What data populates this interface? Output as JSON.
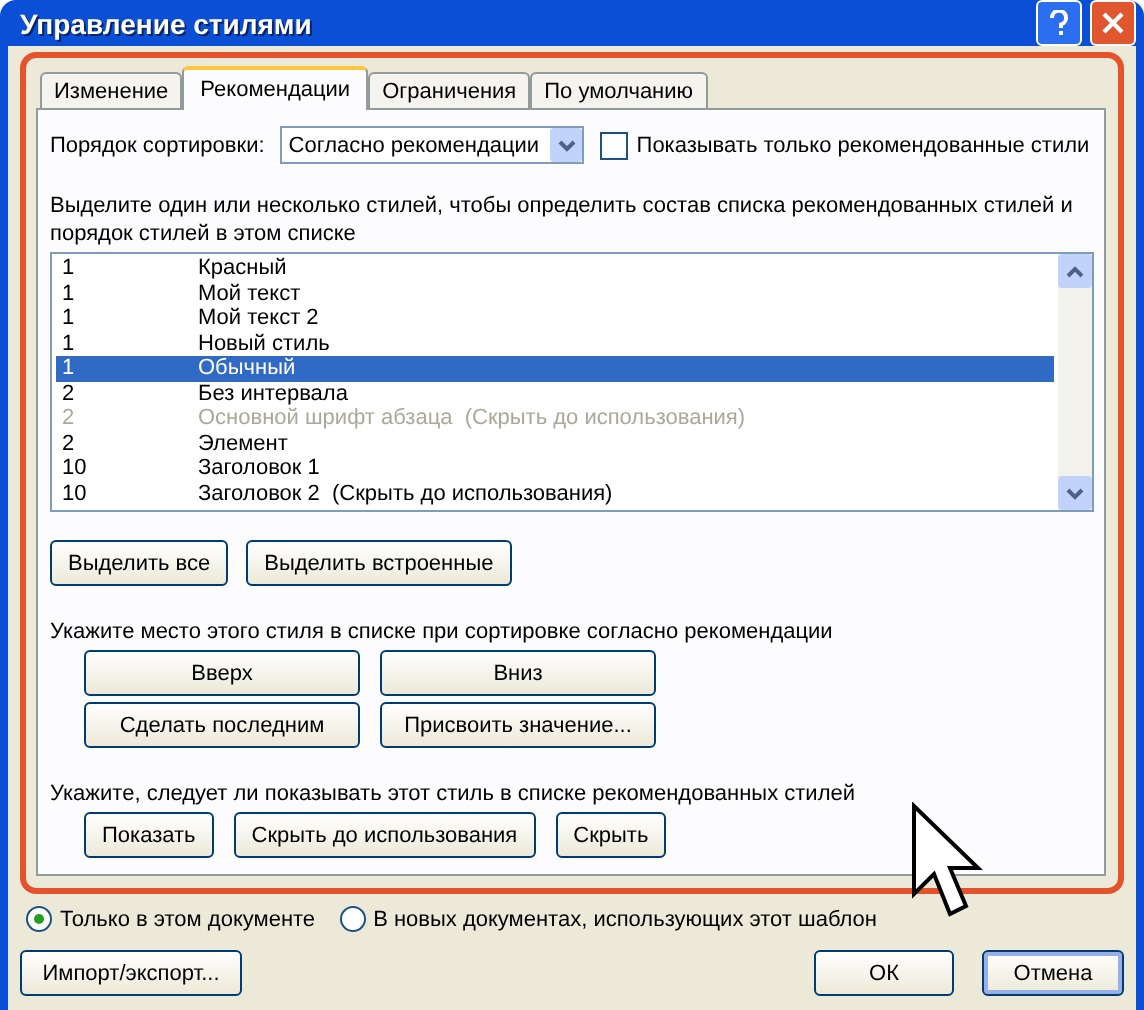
{
  "window": {
    "title": "Управление стилями"
  },
  "tabs": [
    {
      "label": "Изменение",
      "selected": false
    },
    {
      "label": "Рекомендации",
      "selected": true
    },
    {
      "label": "Ограничения",
      "selected": false
    },
    {
      "label": "По умолчанию",
      "selected": false
    }
  ],
  "sort": {
    "label": "Порядок сортировки:",
    "value": "Согласно рекомендации"
  },
  "show_recommended_only": {
    "label": "Показывать только рекомендованные стили",
    "checked": false
  },
  "list_hint": "Выделите один или несколько стилей, чтобы определить состав списка рекомендованных стилей и порядок стилей в этом списке",
  "styles": [
    {
      "priority": "1",
      "name": "Красный",
      "selected": false,
      "disabled": false
    },
    {
      "priority": "1",
      "name": "Мой текст",
      "selected": false,
      "disabled": false
    },
    {
      "priority": "1",
      "name": "Мой текст 2",
      "selected": false,
      "disabled": false
    },
    {
      "priority": "1",
      "name": "Новый стиль",
      "selected": false,
      "disabled": false
    },
    {
      "priority": "1",
      "name": "Обычный",
      "selected": true,
      "disabled": false
    },
    {
      "priority": "2",
      "name": "Без интервала",
      "selected": false,
      "disabled": false
    },
    {
      "priority": "2",
      "name": "Основной шрифт абзаца  (Скрыть до использования)",
      "selected": false,
      "disabled": true
    },
    {
      "priority": "2",
      "name": "Элемент",
      "selected": false,
      "disabled": false
    },
    {
      "priority": "10",
      "name": "Заголовок 1",
      "selected": false,
      "disabled": false
    },
    {
      "priority": "10",
      "name": "Заголовок 2  (Скрыть до использования)",
      "selected": false,
      "disabled": false
    }
  ],
  "select_buttons": [
    "Выделить все",
    "Выделить встроенные"
  ],
  "position_hint": "Укажите место этого стиля в списке при сортировке согласно рекомендации",
  "position_buttons": [
    "Вверх",
    "Вниз",
    "Сделать последним",
    "Присвоить значение..."
  ],
  "visibility_hint": "Укажите, следует ли показывать этот стиль в списке рекомендованных стилей",
  "visibility_buttons": [
    "Показать",
    "Скрыть до использования",
    "Скрыть"
  ],
  "scope": [
    {
      "label": "Только в этом документе",
      "selected": true
    },
    {
      "label": "В новых документах, использующих этот шаблон",
      "selected": false
    }
  ],
  "import_button": "Импорт/экспорт...",
  "ok_button": "ОК",
  "cancel_button": "Отмена"
}
